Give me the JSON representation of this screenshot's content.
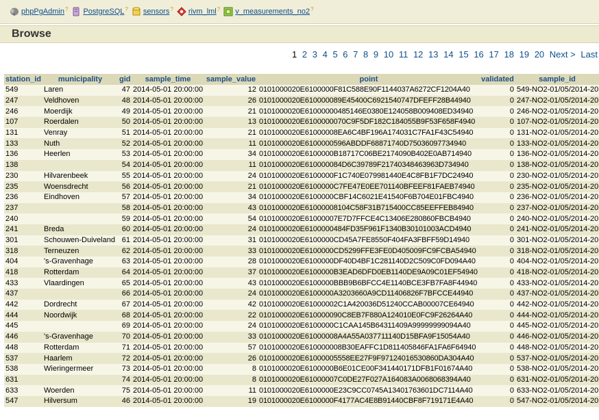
{
  "breadcrumb": [
    {
      "label": "phpPgAdmin",
      "icon": "elephant-icon",
      "sep": "?"
    },
    {
      "label": "PostgreSQL",
      "icon": "server-icon",
      "sep": "?"
    },
    {
      "label": "sensors",
      "icon": "database-icon",
      "sep": "?"
    },
    {
      "label": "rivm_lml",
      "icon": "schema-icon",
      "sep": "?"
    },
    {
      "label": "v_measurements_no2",
      "icon": "view-icon",
      "sep": "?"
    }
  ],
  "page_title": "Browse",
  "pager": {
    "current": "1",
    "pages": [
      "2",
      "3",
      "4",
      "5",
      "6",
      "7",
      "8",
      "9",
      "10",
      "11",
      "12",
      "13",
      "14",
      "15",
      "16",
      "17",
      "18",
      "19",
      "20"
    ],
    "next": "Next >",
    "last": "Last >>"
  },
  "columns": [
    "station_id",
    "municipality",
    "gid",
    "sample_time",
    "sample_value",
    "point",
    "validated",
    "sample_id"
  ],
  "rows": [
    [
      "549",
      "Laren",
      "47",
      "2014-05-01 20:00:00",
      "12",
      "0101000020E6100000F81C588E90F1144037A6272CF1204A40",
      "0",
      "549-NO2-01/05/2014-20"
    ],
    [
      "247",
      "Veldhoven",
      "48",
      "2014-05-01 20:00:00",
      "26",
      "0101000020E610000089E45400C6921540747DFEFF28B44940",
      "0",
      "247-NO2-01/05/2014-20"
    ],
    [
      "246",
      "Moerdijk",
      "49",
      "2014-05-01 20:00:00",
      "21",
      "0101000020E61000000485146E0380E124058B009408ED34940",
      "0",
      "246-NO2-01/05/2014-20"
    ],
    [
      "107",
      "Roerdalen",
      "50",
      "2014-05-01 20:00:00",
      "13",
      "0101000020E6100000070C9F5DF182C184055B9F53F658F4940",
      "0",
      "107-NO2-01/05/2014-20"
    ],
    [
      "131",
      "Venray",
      "51",
      "2014-05-01 20:00:00",
      "21",
      "0101000020E61000008EA6C4BF196A174031C7FA1F43C54940",
      "0",
      "131-NO2-01/05/2014-20"
    ],
    [
      "133",
      "Nuth",
      "52",
      "2014-05-01 20:00:00",
      "11",
      "0101000020E6100000596ABDDF68871740D75036097734940",
      "0",
      "133-NO2-01/05/2014-20"
    ],
    [
      "136",
      "Heerlen",
      "53",
      "2014-05-01 20:00:00",
      "34",
      "0101000020E6100000B18717C06BE2174090B402E0AB714940",
      "0",
      "136-NO2-01/05/2014-20"
    ],
    [
      "138",
      "",
      "54",
      "2014-05-01 20:00:00",
      "11",
      "0101000020E610000084D6C39789F21740348463963D734940",
      "0",
      "138-NO2-01/05/2014-20"
    ],
    [
      "230",
      "Hilvarenbeek",
      "55",
      "2014-05-01 20:00:00",
      "24",
      "0101000020E6100000F1C740E079981440E4C8FB1F7DC24940",
      "0",
      "230-NO2-01/05/2014-20"
    ],
    [
      "235",
      "Woensdrecht",
      "56",
      "2014-05-01 20:00:00",
      "21",
      "0101000020E6100000C7FE47E0EE701140BFEEF81FAEB74940",
      "0",
      "235-NO2-01/05/2014-20"
    ],
    [
      "236",
      "Eindhoven",
      "57",
      "2014-05-01 20:00:00",
      "34",
      "0101000020E6100000CBF14C6021E41540F6B704E01FBC4940",
      "0",
      "236-NO2-01/05/2014-20"
    ],
    [
      "237",
      "",
      "58",
      "2014-05-01 20:00:00",
      "43",
      "0101000020E61000008104C58F31B715400CC85EEFFEB84940",
      "0",
      "237-NO2-01/05/2014-20"
    ],
    [
      "240",
      "",
      "59",
      "2014-05-01 20:00:00",
      "54",
      "0101000020E61000007E7D7FFCE4C13406E280860FBCB4940",
      "0",
      "240-NO2-01/05/2014-20"
    ],
    [
      "241",
      "Breda",
      "60",
      "2014-05-01 20:00:00",
      "24",
      "0101000020E6100000484FD35F961F1340B30101003ACD4940",
      "0",
      "241-NO2-01/05/2014-20"
    ],
    [
      "301",
      "Schouwen-Duiveland",
      "61",
      "2014-05-01 20:00:00",
      "31",
      "0101000020E6100000CD45A7FE8550F404FA3FBFF59D14940",
      "0",
      "301-NO2-01/05/2014-20"
    ],
    [
      "318",
      "Terneuzen",
      "62",
      "2014-05-01 20:00:00",
      "33",
      "0101000020E6100000CD5299FFE3FE0D405009FC9FCBA54940",
      "0",
      "318-NO2-01/05/2014-20"
    ],
    [
      "404",
      "'s-Gravenhage",
      "63",
      "2014-05-01 20:00:00",
      "28",
      "0101000020E6100000DF40D4BF1C281140D2C509C0FD094A40",
      "0",
      "404-NO2-01/05/2014-20"
    ],
    [
      "418",
      "Rotterdam",
      "64",
      "2014-05-01 20:00:00",
      "37",
      "0101000020E6100000B3EAD6DFD0EB1140DE9A09C01EF54940",
      "0",
      "418-NO2-01/05/2014-20"
    ],
    [
      "433",
      "Vlaardingen",
      "65",
      "2014-05-01 20:00:00",
      "43",
      "0101000020E6100000BBB9B6BFCC4E1140BCE3FB7FA8F44940",
      "0",
      "433-NO2-01/05/2014-20"
    ],
    [
      "437",
      "",
      "66",
      "2014-05-01 20:00:00",
      "24",
      "0101000020E6100000A3203660A9CD11406826F7BFCCE44940",
      "0",
      "437-NO2-01/05/2014-20"
    ],
    [
      "442",
      "Dordrecht",
      "67",
      "2014-05-01 20:00:00",
      "42",
      "0101000020E61000002C1A420036D51240CCAB00007CE64940",
      "0",
      "442-NO2-01/05/2014-20"
    ],
    [
      "444",
      "Noordwijk",
      "68",
      "2014-05-01 20:00:00",
      "22",
      "0101000020E610000090C8EB7F880A124010E0FC9F26264A40",
      "0",
      "444-NO2-01/05/2014-20"
    ],
    [
      "445",
      "",
      "69",
      "2014-05-01 20:00:00",
      "24",
      "0101000020E6100000C1CAA145B64311409A99999999094A40",
      "0",
      "445-NO2-01/05/2014-20"
    ],
    [
      "446",
      "'s-Gravenhage",
      "70",
      "2014-05-01 20:00:00",
      "33",
      "0101000020E61000008A4A55A037711140D15BFA9F15054A40",
      "0",
      "446-NO2-01/05/2014-20"
    ],
    [
      "448",
      "Rotterdam",
      "71",
      "2014-05-01 20:00:00",
      "57",
      "0101000020E610000008B30EAFFC1D811405846FA1FA6F64940",
      "0",
      "448-NO2-01/05/2014-20"
    ],
    [
      "537",
      "Haarlem",
      "72",
      "2014-05-01 20:00:00",
      "26",
      "0101000020E61000005558EE27F9F97124016530860DA304A40",
      "0",
      "537-NO2-01/05/2014-20"
    ],
    [
      "538",
      "Wieringermeer",
      "73",
      "2014-05-01 20:00:00",
      "8",
      "0101000020E6100000B6E01CE00F341440171DFB1F01674A40",
      "0",
      "538-NO2-01/05/2014-20"
    ],
    [
      "631",
      "",
      "74",
      "2014-05-01 20:00:00",
      "8",
      "0101000020E61000007C0DE27F027A164083A0068068394A40",
      "0",
      "631-NO2-01/05/2014-20"
    ],
    [
      "633",
      "Woerden",
      "75",
      "2014-05-01 20:00:00",
      "11",
      "0101000020E6100000E23C9CC0745A13401763601DC7114A40",
      "0",
      "633-NO2-01/05/2014-20"
    ],
    [
      "547",
      "Hilversum",
      "46",
      "2014-05-01 20:00:00",
      "19",
      "0101000020E6100000F4177AC4E8B91440CBF8F719171E4A40",
      "0",
      "547-NO2-01/05/2014-20"
    ]
  ]
}
